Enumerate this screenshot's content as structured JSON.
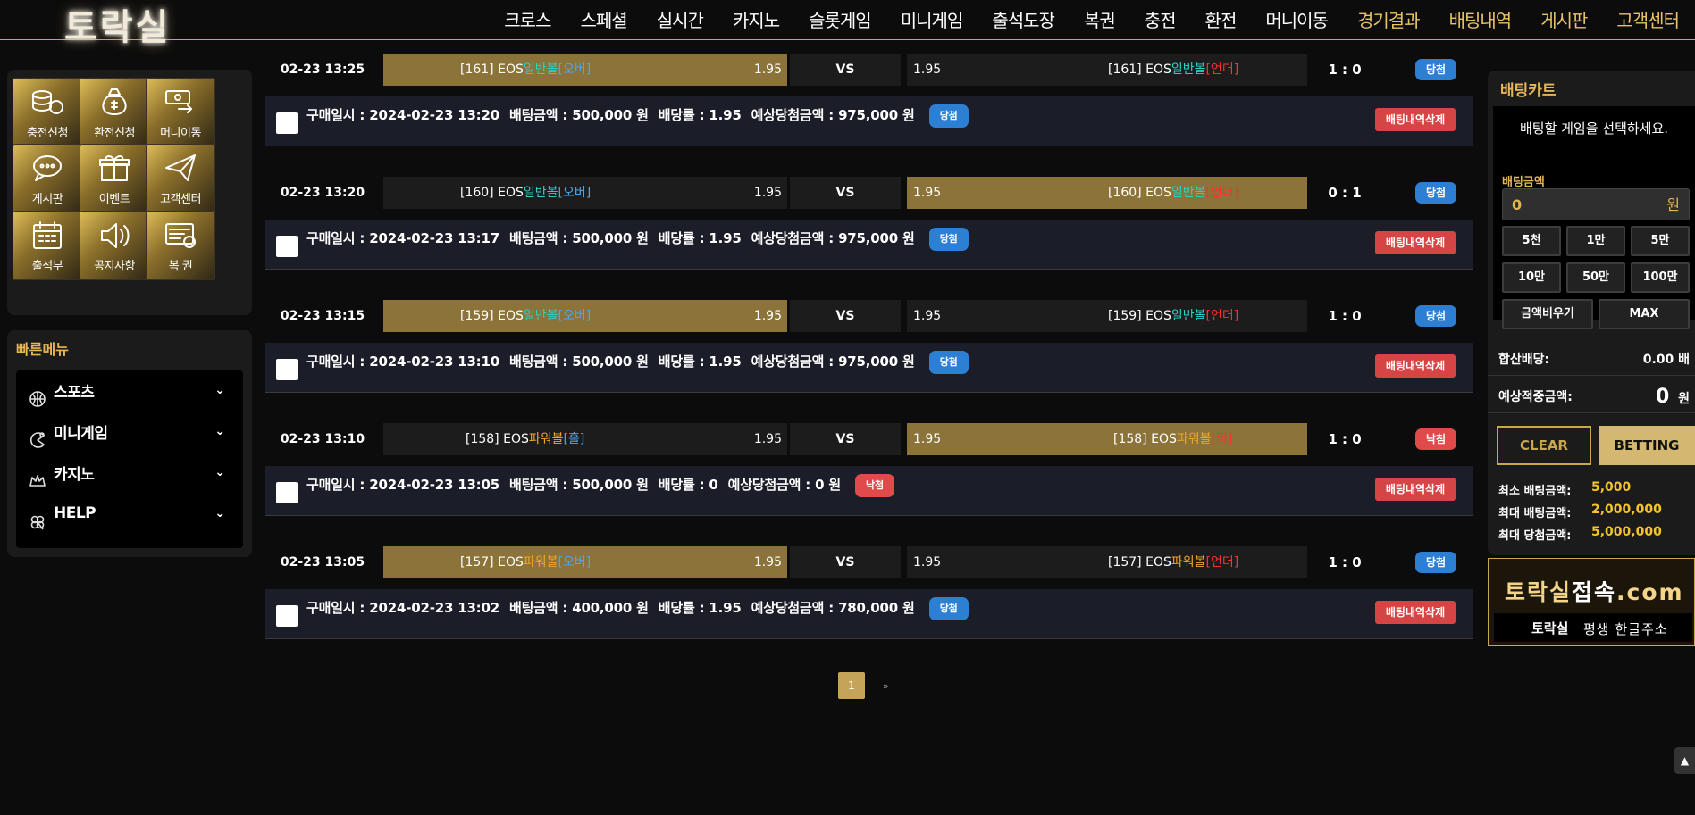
{
  "brand": {
    "logo": "토락실"
  },
  "nav": [
    "크로스",
    "스페셜",
    "실시간",
    "카지노",
    "슬롯게임",
    "미니게임",
    "출석도장",
    "복권",
    "충전",
    "환전",
    "머니이동",
    "경기결과",
    "배팅내역",
    "게시판",
    "고객센터"
  ],
  "nav_gold": [
    "경기결과",
    "배팅내역",
    "게시판",
    "고객센터"
  ],
  "tiles": [
    {
      "label": "충전신청",
      "icon": "coins-icon"
    },
    {
      "label": "환전신청",
      "icon": "money-bag-icon"
    },
    {
      "label": "머니이동",
      "icon": "money-transfer-icon"
    },
    {
      "label": "게시판",
      "icon": "chat-bubble-icon"
    },
    {
      "label": "이벤트",
      "icon": "gift-icon"
    },
    {
      "label": "고객센터",
      "icon": "paper-plane-icon"
    },
    {
      "label": "출석부",
      "icon": "calendar-icon"
    },
    {
      "label": "공지사항",
      "icon": "speaker-icon"
    },
    {
      "label": "복 권",
      "icon": "lottery-icon"
    }
  ],
  "quick_menu": {
    "title": "빠른메뉴",
    "items": [
      {
        "label": "스포츠",
        "icon": "basketball-icon"
      },
      {
        "label": "미니게임",
        "icon": "pacman-icon"
      },
      {
        "label": "카지노",
        "icon": "crown-icon"
      },
      {
        "label": "HELP",
        "icon": "clover-icon"
      }
    ]
  },
  "bets": [
    {
      "date": "02-23 13:25",
      "home": {
        "num": "[161] EOS",
        "game": "일반볼",
        "pick": "[오버]",
        "odds": "1.95"
      },
      "away": {
        "num": "[161] EOS",
        "game": "일반볼",
        "pick": "[언더]",
        "odds": "1.95"
      },
      "selected": "home",
      "score": "1 : 0",
      "result": "당첨",
      "result_color": "blue",
      "purchase": "구매일시 : 2024-02-23 13:20",
      "amount": "배팅금액 : 500,000 원",
      "rate": "배당률 : 1.95",
      "expected": "예상당첨금액 : 975,000 원",
      "delete": "배팅내역삭제"
    },
    {
      "date": "02-23 13:20",
      "home": {
        "num": "[160] EOS",
        "game": "일반볼",
        "pick": "[오버]",
        "odds": "1.95"
      },
      "away": {
        "num": "[160] EOS",
        "game": "일반볼",
        "pick": "[언더]",
        "odds": "1.95"
      },
      "selected": "away",
      "score": "0 : 1",
      "result": "당첨",
      "result_color": "blue",
      "purchase": "구매일시 : 2024-02-23 13:17",
      "amount": "배팅금액 : 500,000 원",
      "rate": "배당률 : 1.95",
      "expected": "예상당첨금액 : 975,000 원",
      "delete": "배팅내역삭제"
    },
    {
      "date": "02-23 13:15",
      "home": {
        "num": "[159] EOS",
        "game": "일반볼",
        "pick": "[오버]",
        "odds": "1.95"
      },
      "away": {
        "num": "[159] EOS",
        "game": "일반볼",
        "pick": "[언더]",
        "odds": "1.95"
      },
      "selected": "home",
      "score": "1 : 0",
      "result": "당첨",
      "result_color": "blue",
      "purchase": "구매일시 : 2024-02-23 13:10",
      "amount": "배팅금액 : 500,000 원",
      "rate": "배당률 : 1.95",
      "expected": "예상당첨금액 : 975,000 원",
      "delete": "배팅내역삭제"
    },
    {
      "date": "02-23 13:10",
      "home": {
        "num": "[158] EOS",
        "game": "파워볼",
        "pick": "[홀]",
        "odds": "1.95"
      },
      "away": {
        "num": "[158] EOS",
        "game": "파워볼",
        "pick": "[짝]",
        "odds": "1.95"
      },
      "selected": "away",
      "score": "1 : 0",
      "result": "낙첨",
      "result_color": "red",
      "purchase": "구매일시 : 2024-02-23 13:05",
      "amount": "배팅금액 : 500,000 원",
      "rate": "배당률 : 0",
      "expected": "예상당첨금액 : 0 원",
      "delete": "배팅내역삭제"
    },
    {
      "date": "02-23 13:05",
      "home": {
        "num": "[157] EOS",
        "game": "파워볼",
        "pick": "[오버]",
        "odds": "1.95"
      },
      "away": {
        "num": "[157] EOS",
        "game": "파워볼",
        "pick": "[언더]",
        "odds": "1.95"
      },
      "selected": "home",
      "score": "1 : 0",
      "result": "당첨",
      "result_color": "blue",
      "purchase": "구매일시 : 2024-02-23 13:02",
      "amount": "배팅금액 : 400,000 원",
      "rate": "배당률 : 1.95",
      "expected": "예상당첨금액 : 780,000 원",
      "delete": "배팅내역삭제"
    }
  ],
  "vs_label": "VS",
  "pagination": {
    "current": "1",
    "next": "»"
  },
  "cart": {
    "title": "배팅카트",
    "message": "배팅할 게임을 선택하세요.",
    "amount_label": "배팅금액",
    "amount_value": "0",
    "amount_unit": "원",
    "quick_buttons": [
      "5천",
      "1만",
      "5만",
      "10만",
      "50만",
      "100만"
    ],
    "clear_amount": "금액비우기",
    "max": "MAX",
    "combined_odds_label": "합산배당:",
    "combined_odds_value": "0.00 배",
    "expected_label": "예상적중금액:",
    "expected_value": "0",
    "expected_unit": "원",
    "clear": "CLEAR",
    "betting": "BETTING",
    "limits": [
      {
        "label": "최소 배팅금액:",
        "value": "5,000"
      },
      {
        "label": "최대 배팅금액:",
        "value": "2,000,000"
      },
      {
        "label": "최대 당첨금액:",
        "value": "5,000,000"
      }
    ]
  },
  "banner": {
    "part1": "토락실",
    "part2": "접속",
    "part3": ".com",
    "sub_brand": "토락실",
    "sub_text": "평생 한글주소"
  },
  "colors": {
    "gold": "#c9a74a",
    "win_bg": "#8b733a",
    "teal": "#2bd2c4",
    "orange": "#f0a52a",
    "red_text": "#ff3030",
    "blue_text": "#4fa6e8",
    "badge_blue": "#2d7fd4",
    "badge_red": "#e04a4a"
  }
}
